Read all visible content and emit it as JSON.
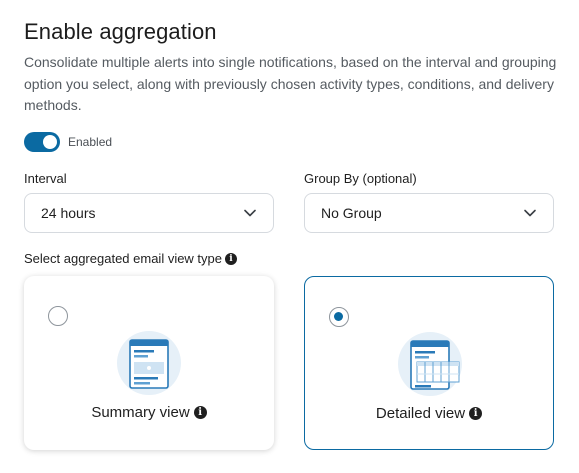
{
  "header": {
    "title": "Enable aggregation",
    "description": "Consolidate multiple alerts into single notifications, based on the interval and grouping option you select, along with previously chosen activity types, conditions, and delivery methods."
  },
  "toggle": {
    "label": "Enabled",
    "on": true,
    "color": "#0b6aa2"
  },
  "interval": {
    "label": "Interval",
    "value": "24 hours"
  },
  "group_by": {
    "label": "Group By (optional)",
    "value": "No Group"
  },
  "view_type": {
    "label": "Select aggregated email view type",
    "options": [
      {
        "label": "Summary view",
        "selected": false,
        "icon": "summary-view-icon"
      },
      {
        "label": "Detailed view",
        "selected": true,
        "icon": "detailed-view-icon"
      }
    ]
  },
  "colors": {
    "accent": "#0b6aa2",
    "border": "#d6dadf",
    "muted_text": "#555b61"
  }
}
